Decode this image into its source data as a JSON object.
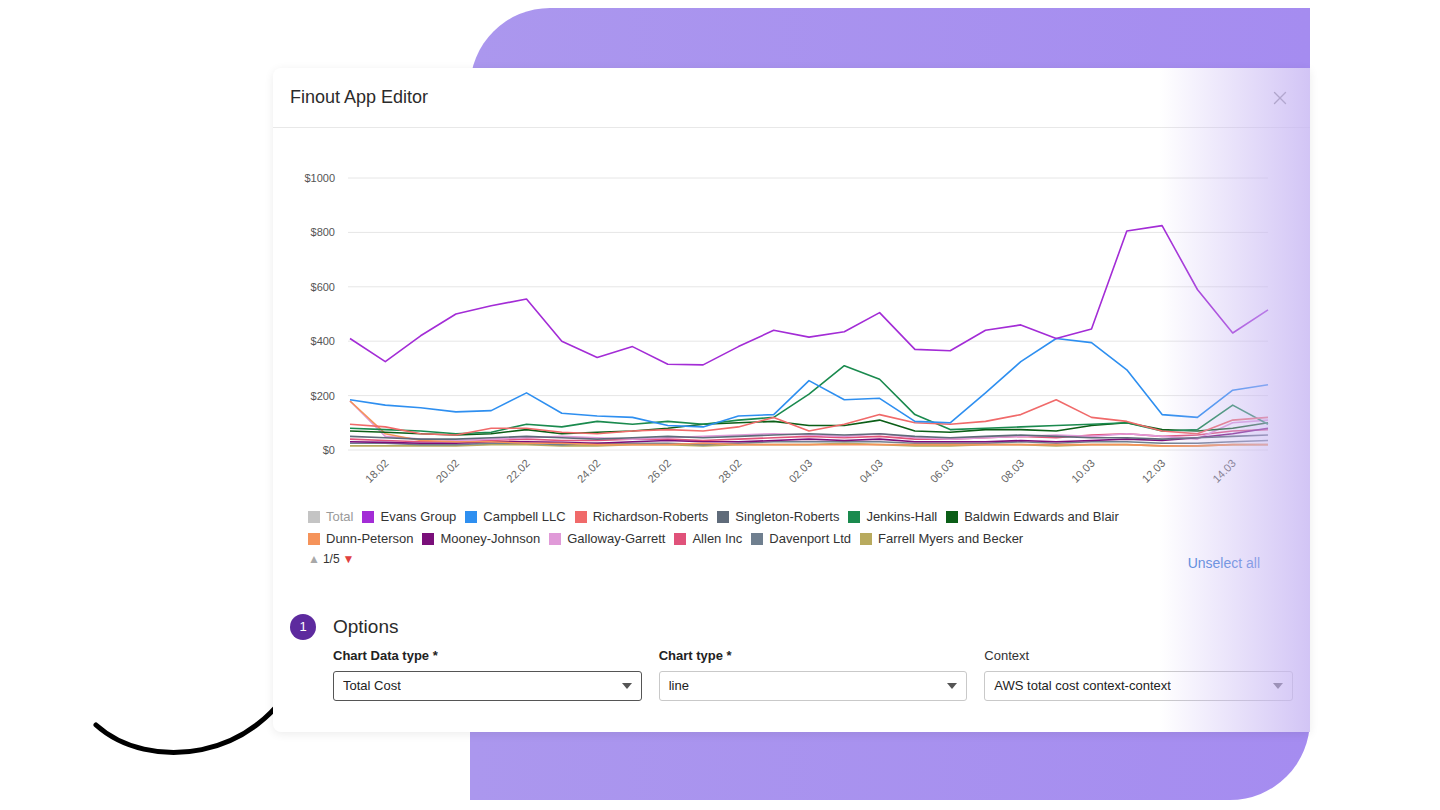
{
  "window": {
    "title": "Finout App Editor",
    "close": "×"
  },
  "chart": {
    "y_ticks": [
      {
        "label": "$1000",
        "value": 1000
      },
      {
        "label": "$800",
        "value": 800
      },
      {
        "label": "$600",
        "value": 600
      },
      {
        "label": "$400",
        "value": 400
      },
      {
        "label": "$200",
        "value": 200
      },
      {
        "label": "$0",
        "value": 0
      }
    ],
    "x_labels": [
      "18.02",
      "20.02",
      "22.02",
      "24.02",
      "26.02",
      "28.02",
      "02.03",
      "04.03",
      "06.03",
      "08.03",
      "10.03",
      "12.03",
      "14.03"
    ],
    "series": [
      {
        "name": "Total",
        "color": "#c4c4c4",
        "selected": false,
        "values": []
      },
      {
        "name": "Evans Group",
        "color": "#a32cd6",
        "selected": true,
        "values": [
          410,
          325,
          420,
          500,
          530,
          555,
          400,
          340,
          380,
          315,
          313,
          380,
          440,
          415,
          435,
          505,
          370,
          365,
          440,
          460,
          410,
          445,
          805,
          825,
          590,
          430,
          515
        ]
      },
      {
        "name": "Campbell LLC",
        "color": "#2e8ff0",
        "selected": true,
        "values": [
          185,
          165,
          155,
          140,
          145,
          210,
          135,
          125,
          120,
          90,
          85,
          125,
          130,
          255,
          185,
          190,
          105,
          100,
          210,
          325,
          410,
          395,
          295,
          130,
          120,
          220,
          240
        ]
      },
      {
        "name": "Richardson-Roberts",
        "color": "#f06a6a",
        "selected": true,
        "values": [
          95,
          85,
          60,
          55,
          80,
          80,
          65,
          60,
          70,
          75,
          70,
          85,
          120,
          70,
          95,
          130,
          100,
          95,
          105,
          130,
          185,
          120,
          105,
          70,
          60,
          110,
          120
        ]
      },
      {
        "name": "Singleton-Roberts",
        "color": "#5f6b7a",
        "selected": true,
        "values": [
          50,
          45,
          40,
          40,
          45,
          50,
          45,
          40,
          45,
          50,
          45,
          50,
          55,
          60,
          55,
          60,
          50,
          45,
          50,
          55,
          50,
          45,
          45,
          40,
          45,
          50,
          55
        ]
      },
      {
        "name": "Jenkins-Hall",
        "color": "#1a8a4e",
        "selected": true,
        "values": [
          80,
          75,
          70,
          60,
          65,
          95,
          85,
          105,
          95,
          105,
          95,
          110,
          120,
          205,
          310,
          260,
          130,
          75,
          80,
          85,
          90,
          95,
          100,
          70,
          75,
          165,
          95
        ]
      },
      {
        "name": "Baldwin Edwards and Blair",
        "color": "#0b5e17",
        "selected": true,
        "values": [
          70,
          65,
          60,
          55,
          60,
          75,
          60,
          65,
          70,
          80,
          95,
          100,
          105,
          90,
          90,
          110,
          70,
          65,
          75,
          75,
          70,
          90,
          100,
          75,
          70,
          80,
          100
        ]
      },
      {
        "name": "Dunn-Peterson",
        "color": "#f5935a",
        "selected": true,
        "values": [
          180,
          60,
          35,
          30,
          30,
          25,
          25,
          20,
          20,
          20,
          25,
          20,
          20,
          20,
          20,
          20,
          20,
          20,
          20,
          20,
          20,
          20,
          20,
          15,
          15,
          20,
          20
        ]
      },
      {
        "name": "Mooney-Johnson",
        "color": "#7a0f7a",
        "selected": true,
        "values": [
          30,
          28,
          25,
          25,
          30,
          30,
          28,
          25,
          30,
          35,
          30,
          30,
          35,
          40,
          35,
          40,
          30,
          30,
          30,
          35,
          30,
          35,
          40,
          35,
          45,
          60,
          80
        ]
      },
      {
        "name": "Galloway-Garrett",
        "color": "#e09ad8",
        "selected": true,
        "values": [
          180,
          50,
          40,
          35,
          40,
          45,
          50,
          45,
          40,
          45,
          50,
          55,
          60,
          55,
          50,
          60,
          45,
          40,
          45,
          50,
          55,
          50,
          60,
          50,
          40,
          100,
          110
        ]
      },
      {
        "name": "Allen Inc",
        "color": "#e0527a",
        "selected": true,
        "values": [
          40,
          35,
          30,
          30,
          35,
          40,
          35,
          35,
          40,
          40,
          35,
          40,
          45,
          50,
          45,
          50,
          40,
          40,
          45,
          50,
          45,
          55,
          60,
          50,
          55,
          70,
          75
        ]
      },
      {
        "name": "Davenport Ltd",
        "color": "#6f7f8f",
        "selected": true,
        "values": [
          25,
          25,
          20,
          20,
          25,
          25,
          20,
          25,
          25,
          25,
          20,
          25,
          30,
          30,
          30,
          30,
          25,
          25,
          25,
          30,
          25,
          30,
          30,
          25,
          25,
          30,
          35
        ]
      },
      {
        "name": "Farrell Myers and Becker",
        "color": "#b8aa5e",
        "selected": true,
        "values": [
          15,
          15,
          15,
          15,
          20,
          20,
          15,
          15,
          20,
          20,
          15,
          20,
          20,
          20,
          25,
          20,
          15,
          15,
          20,
          20,
          15,
          20,
          20,
          15,
          15,
          20,
          20
        ]
      }
    ],
    "pager": {
      "up": "▲",
      "up_disabled": true,
      "page": "1/5",
      "down": "▼",
      "down_disabled": false
    },
    "unselect_all": "Unselect all"
  },
  "options": {
    "step": "1",
    "title": "Options",
    "fields": [
      {
        "label": "Chart Data type *",
        "value": "Total Cost",
        "required": true,
        "focused": true
      },
      {
        "label": "Chart type *",
        "value": "line",
        "required": true,
        "focused": false
      },
      {
        "label": "Context",
        "value": "AWS total cost context-context",
        "required": false,
        "focused": false
      }
    ]
  }
}
